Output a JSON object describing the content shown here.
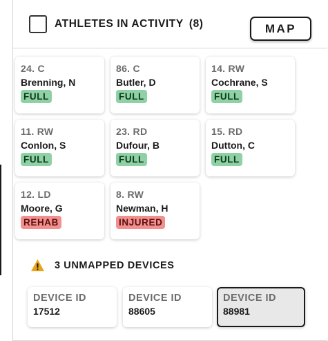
{
  "header": {
    "title": "ATHLETES IN ACTIVITY",
    "count": "(8)",
    "map_button": "MAP"
  },
  "athletes": [
    {
      "position": "24. C",
      "name": "Brenning, N",
      "status": "FULL",
      "status_type": "full"
    },
    {
      "position": "86. C",
      "name": "Butler, D",
      "status": "FULL",
      "status_type": "full"
    },
    {
      "position": "14. RW",
      "name": "Cochrane, S",
      "status": "FULL",
      "status_type": "full"
    },
    {
      "position": "11. RW",
      "name": "Conlon, S",
      "status": "FULL",
      "status_type": "full"
    },
    {
      "position": "23. RD",
      "name": "Dufour, B",
      "status": "FULL",
      "status_type": "full"
    },
    {
      "position": "15. RD",
      "name": "Dutton, C",
      "status": "FULL",
      "status_type": "full"
    },
    {
      "position": "12. LD",
      "name": "Moore, G",
      "status": "REHAB",
      "status_type": "rehab"
    },
    {
      "position": "8. RW",
      "name": "Newman, H",
      "status": "INJURED",
      "status_type": "injured"
    }
  ],
  "unmapped": {
    "label": "3 UNMAPPED DEVICES",
    "icon": "warning-icon",
    "icon_color": "#e8a317"
  },
  "devices": [
    {
      "label": "DEVICE ID",
      "id": "17512",
      "selected": false
    },
    {
      "label": "DEVICE ID",
      "id": "88605",
      "selected": false
    },
    {
      "label": "DEVICE ID",
      "id": "88981",
      "selected": true
    }
  ],
  "colors": {
    "full_badge": "#8fd0a4",
    "alert_badge": "#f28f8f"
  }
}
